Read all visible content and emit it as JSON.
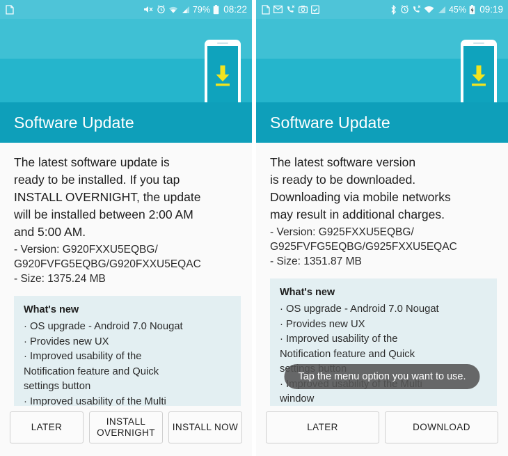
{
  "left": {
    "statusbar": {
      "notif_icons": [
        "document-icon"
      ],
      "mute_icon": "mute-icon",
      "alarm_icon": "alarm-icon",
      "wifi_icon": "wifi-icon",
      "signal_icon": "signal-icon",
      "battery_percent": "79%",
      "battery_icon": "battery-icon",
      "clock": "08:22"
    },
    "illustration": {
      "phone_icon": "phone-download-icon",
      "arrow_icon": "download-arrow-icon"
    },
    "title": "Software Update",
    "lead": "The latest software update is\nready to be installed. If you tap\nINSTALL OVERNIGHT, the update\nwill be installed between 2:00 AM\nand 5:00 AM.",
    "meta": " - Version: G920FXXU5EQBG/\nG920FVFG5EQBG/G920FXXU5EQAC\n - Size: 1375.24 MB",
    "whatsnew": {
      "title": "What's new",
      "items": "· OS upgrade - Android 7.0 Nougat\n· Provides new UX\n· Improved usability of the\nNotification feature and Quick\nsettings button\n· Improved usability of the Multi\nwindow"
    },
    "buttons": [
      {
        "label": "LATER",
        "name": "later-button"
      },
      {
        "label": "INSTALL\nOVERNIGHT",
        "name": "install-overnight-button"
      },
      {
        "label": "INSTALL NOW",
        "name": "install-now-button"
      }
    ]
  },
  "right": {
    "statusbar": {
      "notif_icons": [
        "document-icon",
        "mail-icon",
        "missed-call-icon",
        "camera-icon",
        "clipboard-icon"
      ],
      "bluetooth_icon": "bluetooth-icon",
      "alarm_icon": "alarm-icon",
      "call_icon": "missed-call-icon",
      "wifi_icon": "wifi-icon",
      "signal_icon": "signal-icon",
      "battery_percent": "45%",
      "battery_icon": "battery-charging-icon",
      "clock": "09:19"
    },
    "illustration": {
      "phone_icon": "phone-download-icon",
      "arrow_icon": "download-arrow-icon"
    },
    "title": "Software Update",
    "lead": "The latest software version\nis ready to be downloaded.\nDownloading via mobile networks\nmay result in additional charges.",
    "meta": " - Version: G925FXXU5EQBG/\nG925FVFG5EQBG/G925FXXU5EQAC\n - Size: 1351.87 MB",
    "whatsnew": {
      "title": "What's new",
      "items": "· OS upgrade - Android 7.0 Nougat\n· Provides new UX\n· Improved usability of the\nNotification feature and Quick\nsettings button\n· Improved usability of the Multi\nwindow\n· Improved setting menu and"
    },
    "toast": "Tap the menu option you want to use.",
    "buttons": [
      {
        "label": "LATER",
        "name": "later-button"
      },
      {
        "label": "DOWNLOAD",
        "name": "download-button"
      }
    ]
  },
  "colors": {
    "status_bar": "#4ec4d8",
    "hero_top": "#3fc0d4",
    "hero_bottom": "#25b5cc",
    "title_bar": "#0e9fba",
    "accent_arrow": "#f2e41f",
    "whatsnew_bg": "#e3eff2",
    "toast_bg": "#545454",
    "page_bg": "#fafafa"
  }
}
